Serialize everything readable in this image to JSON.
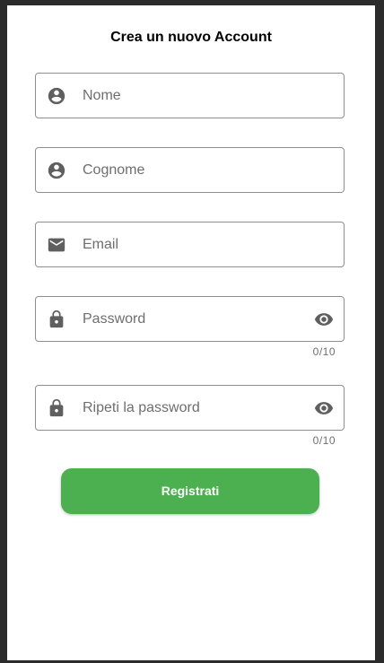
{
  "form": {
    "title": "Crea un nuovo Account",
    "fields": [
      {
        "id": "nome",
        "placeholder": "Nome",
        "icon": "person-icon"
      },
      {
        "id": "cognome",
        "placeholder": "Cognome",
        "icon": "person-icon"
      },
      {
        "id": "email",
        "placeholder": "Email",
        "icon": "mail-icon"
      },
      {
        "id": "password",
        "placeholder": "Password",
        "icon": "lock-icon",
        "trailing_icon": "eye-icon",
        "counter": "0/10"
      },
      {
        "id": "repeat_password",
        "placeholder": "Ripeti la password",
        "icon": "lock-icon",
        "trailing_icon": "eye-icon",
        "counter": "0/10"
      }
    ],
    "submit_label": "Registrati"
  },
  "colors": {
    "accent": "#4caf50",
    "icon": "#5f5f5f",
    "placeholder": "#6e6e6e",
    "border": "#8e8e8e"
  }
}
